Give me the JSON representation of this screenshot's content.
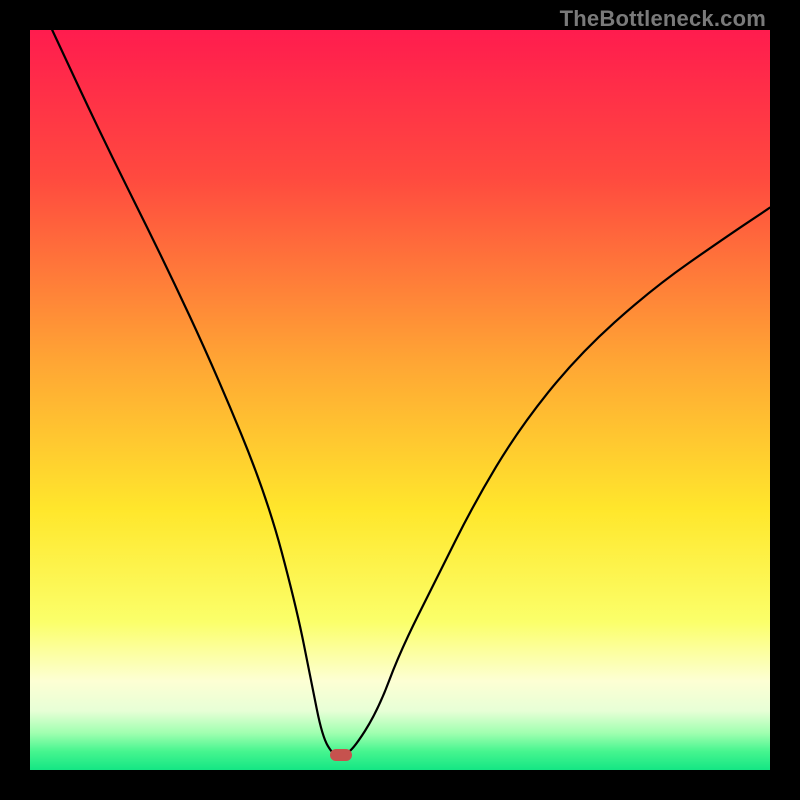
{
  "watermark": "TheBottleneck.com",
  "chart_data": {
    "type": "line",
    "title": "",
    "xlabel": "",
    "ylabel": "",
    "xlim": [
      0,
      100
    ],
    "ylim": [
      0,
      100
    ],
    "series": [
      {
        "name": "curve",
        "x": [
          3,
          10,
          18,
          25,
          32,
          36,
          38,
          39.5,
          41,
          42,
          43.5,
          47,
          50,
          55,
          60,
          66,
          74,
          84,
          94,
          100
        ],
        "values": [
          100,
          85,
          69,
          54,
          37,
          22,
          12,
          4.5,
          2,
          2,
          2.5,
          8,
          16,
          26,
          36,
          46,
          56,
          65,
          72,
          76
        ]
      }
    ],
    "marker": {
      "x": 42,
      "y": 2
    },
    "gradient_stops": [
      {
        "offset": 0,
        "color": "#ff1c4e"
      },
      {
        "offset": 0.2,
        "color": "#ff4a3f"
      },
      {
        "offset": 0.45,
        "color": "#ffa634"
      },
      {
        "offset": 0.65,
        "color": "#ffe72c"
      },
      {
        "offset": 0.8,
        "color": "#fbff6a"
      },
      {
        "offset": 0.88,
        "color": "#fdffd4"
      },
      {
        "offset": 0.92,
        "color": "#e7ffd6"
      },
      {
        "offset": 0.95,
        "color": "#a0ffb0"
      },
      {
        "offset": 0.975,
        "color": "#46f58f"
      },
      {
        "offset": 1.0,
        "color": "#14e684"
      }
    ]
  }
}
